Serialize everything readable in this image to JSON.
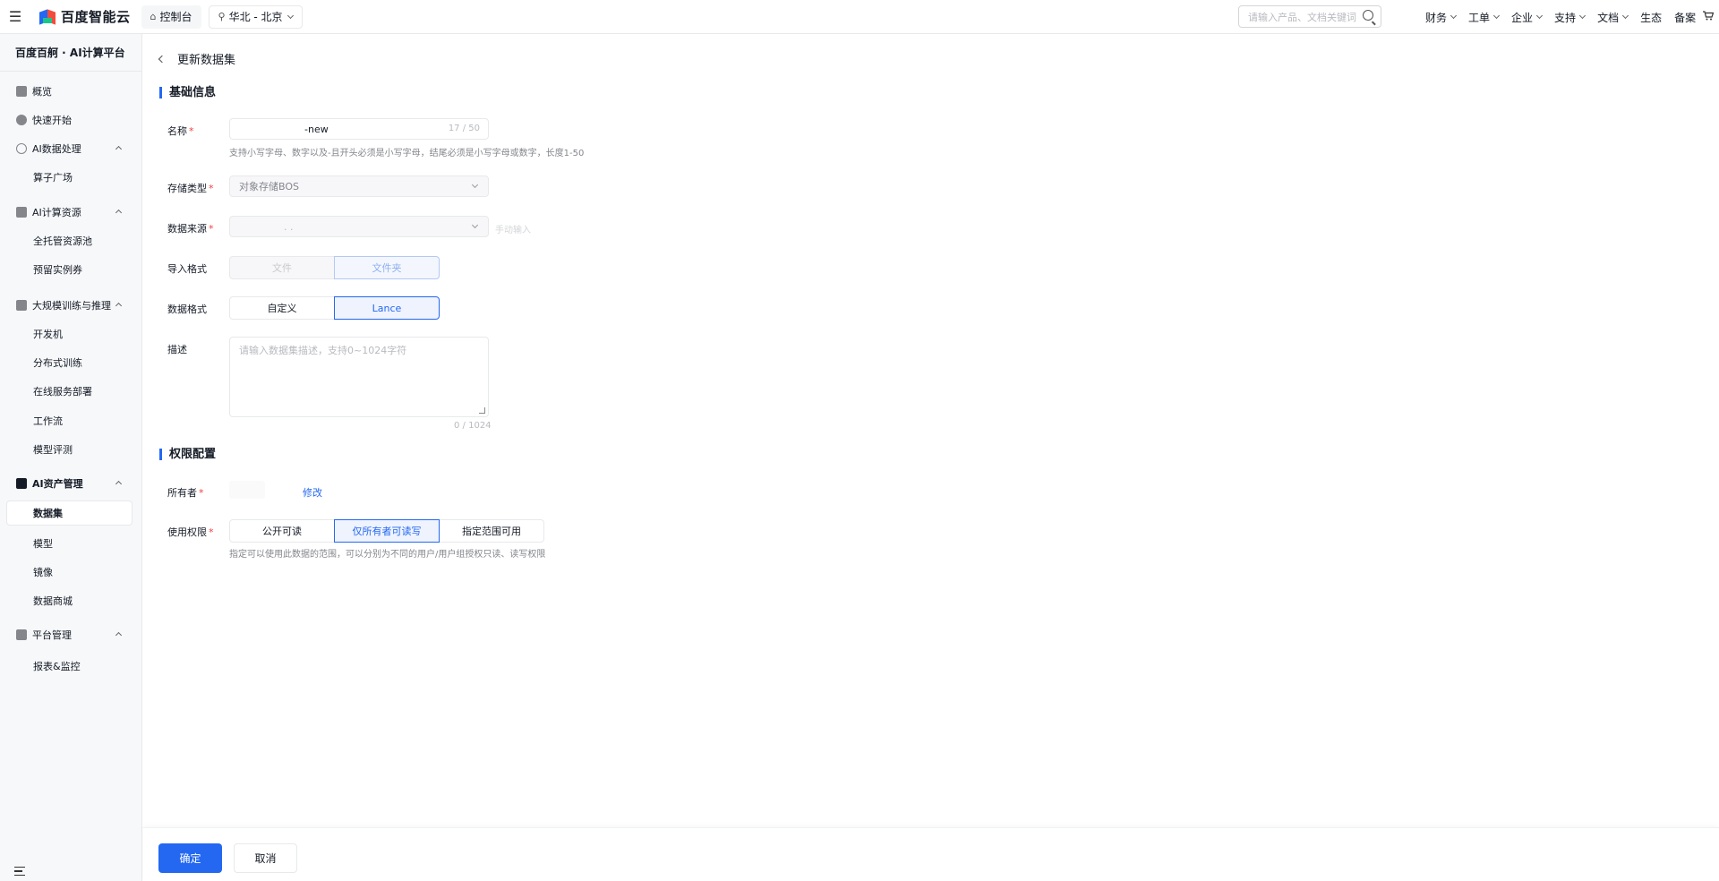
{
  "topbar": {
    "brand": "百度智能云",
    "console": "控制台",
    "region": "华北 - 北京",
    "search_placeholder": "请输入产品、文档关键词",
    "menu": [
      "财务",
      "工单",
      "企业",
      "支持",
      "文档",
      "生态",
      "备案"
    ]
  },
  "sidebar": {
    "title": "百度百舸 · AI计算平台",
    "items": [
      {
        "label": "概览",
        "icon": "home-icon"
      },
      {
        "label": "快速开始",
        "icon": "rocket-icon"
      },
      {
        "label": "AI数据处理",
        "icon": "data-process-icon"
      },
      {
        "label": "算子广场"
      },
      {
        "label": "AI计算资源",
        "icon": "server-icon"
      },
      {
        "label": "全托管资源池"
      },
      {
        "label": "预留实例券"
      },
      {
        "label": "大规模训练与推理",
        "icon": "monitor-icon"
      },
      {
        "label": "开发机"
      },
      {
        "label": "分布式训练"
      },
      {
        "label": "在线服务部署"
      },
      {
        "label": "工作流"
      },
      {
        "label": "模型评测"
      },
      {
        "label": "AI资产管理",
        "icon": "asset-icon"
      },
      {
        "label": "数据集"
      },
      {
        "label": "模型"
      },
      {
        "label": "镜像"
      },
      {
        "label": "数据商城"
      },
      {
        "label": "平台管理",
        "icon": "layers-icon"
      },
      {
        "label": "报表&监控"
      }
    ]
  },
  "page": {
    "title": "更新数据集",
    "basic_section": "基础信息",
    "name_label": "名称",
    "name_value": "-new",
    "name_count": "17 / 50",
    "name_hint": "支持小写字母、数字以及-且开头必须是小写字母，结尾必须是小写字母或数字，长度1-50",
    "storage_label": "存储类型",
    "storage_value": "对象存储BOS",
    "source_label": "数据来源",
    "source_value": ". .",
    "manual_input": "手动输入",
    "import_label": "导入格式",
    "import_options": [
      "文件",
      "文件夹"
    ],
    "format_label": "数据格式",
    "format_options": [
      "自定义",
      "Lance"
    ],
    "desc_label": "描述",
    "desc_placeholder": "请输入数据集描述，支持0~1024字符",
    "desc_count": "0 / 1024",
    "perm_section": "权限配置",
    "owner_label": "所有者",
    "owner_edit": "修改",
    "usage_label": "使用权限",
    "usage_options": [
      "公开可读",
      "仅所有者可读写",
      "指定范围可用"
    ],
    "usage_hint": "指定可以使用此数据的范围，可以分别为不同的用户/用户组授权只读、读写权限"
  },
  "footer": {
    "confirm": "确定",
    "cancel": "取消"
  },
  "colors": {
    "primary": "#2468f2",
    "required": "#f33e3e"
  }
}
